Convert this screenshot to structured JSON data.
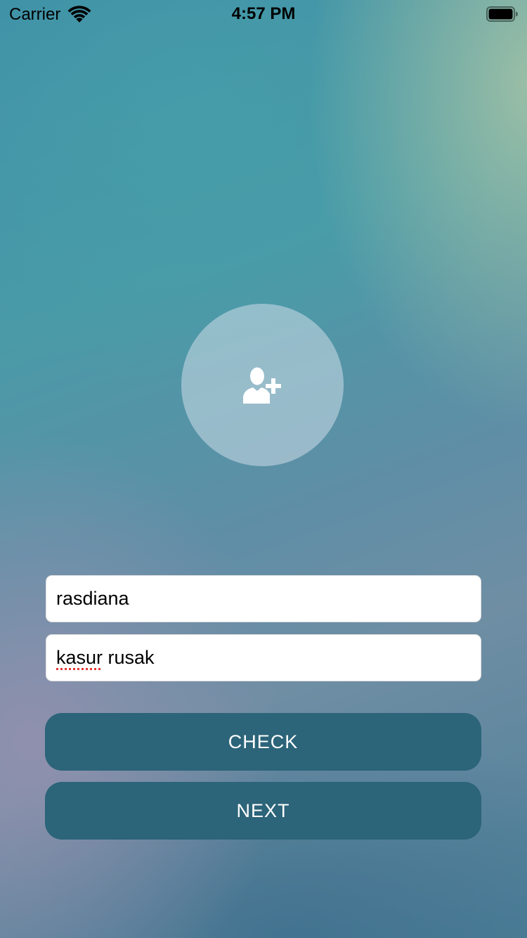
{
  "status_bar": {
    "carrier": "Carrier",
    "time": "4:57 PM",
    "wifi_icon": "wifi-icon",
    "battery_icon": "battery-icon"
  },
  "avatar": {
    "icon": "add-user-icon"
  },
  "form": {
    "name_value": "rasdiana",
    "note_value_misspelled": "kasur",
    "note_value_rest": " rusak"
  },
  "buttons": {
    "check_label": "CHECK",
    "next_label": "NEXT"
  },
  "colors": {
    "button_bg": "#2c6479",
    "field_bg": "#ffffff",
    "spellcheck_underline": "#e53935"
  }
}
